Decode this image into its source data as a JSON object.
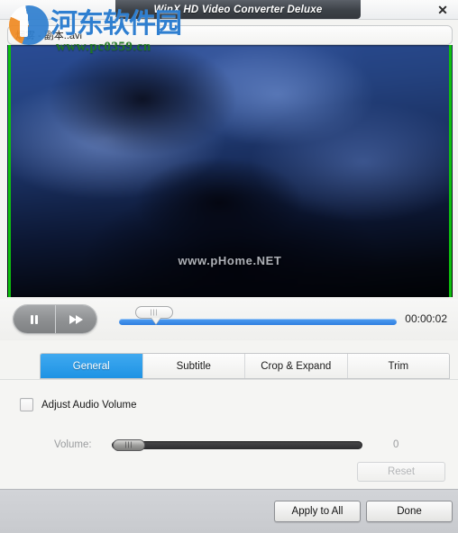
{
  "window": {
    "title": "WinX HD Video Converter Deluxe",
    "close_icon": "close-icon",
    "close_glyph": "✕"
  },
  "file": {
    "name": "烟雾 - 副本..avi"
  },
  "video": {
    "watermark": "www.pHome.NET",
    "crop_guide_color": "#0ec00e"
  },
  "site_watermark": {
    "logo_text": "河东软件园",
    "url_text": "www.pc0359.cn",
    "logo_color": "#2f7fd0",
    "url_color": "#1f7a1f"
  },
  "transport": {
    "pause_icon": "pause-icon",
    "forward_icon": "fast-forward-icon",
    "seek_handle_grip": "|||",
    "time": "00:00:02",
    "progress_percent": 100
  },
  "tabs": [
    {
      "label": "General",
      "active": true
    },
    {
      "label": "Subtitle",
      "active": false
    },
    {
      "label": "Crop & Expand",
      "active": false
    },
    {
      "label": "Trim",
      "active": false
    }
  ],
  "panel": {
    "adjust_audio_label": "Adjust Audio Volume",
    "adjust_audio_checked": false,
    "volume_label": "Volume:",
    "volume_value": "0",
    "volume_handle_grip": "|||",
    "reset_label": "Reset",
    "reset_disabled": true
  },
  "footer": {
    "apply_label": "Apply to All",
    "done_label": "Done"
  },
  "colors": {
    "accent_blue": "#1f93e4",
    "title_bar": "#3c4147",
    "footer_bg": "#c8cace"
  }
}
